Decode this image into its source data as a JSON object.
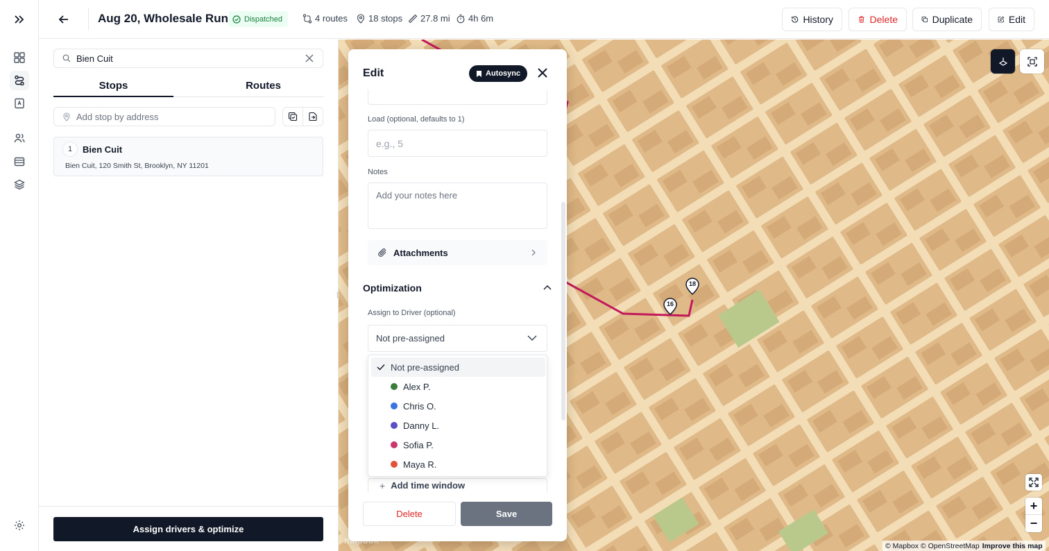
{
  "header": {
    "title": "Aug 20, Wholesale Run",
    "status": "Dispatched",
    "routes": "4 routes",
    "stops": "18 stops",
    "distance": "27.8 mi",
    "duration": "4h 6m",
    "buttons": {
      "history": "History",
      "delete": "Delete",
      "duplicate": "Duplicate",
      "edit": "Edit"
    }
  },
  "left": {
    "search_value": "Bien Cuit",
    "tabs": [
      "Stops",
      "Routes"
    ],
    "active_tab": "Stops",
    "add_stop_placeholder": "Add stop by address",
    "stops": [
      {
        "number": "1",
        "name": "Bien Cuit",
        "address": "Bien Cuit, 120 Smith St, Brooklyn, NY 11201"
      }
    ],
    "assign_button": "Assign drivers & optimize"
  },
  "edit_panel": {
    "title": "Edit",
    "autosync": "Autosync",
    "load_label": "Load (optional, defaults to 1)",
    "load_placeholder": "e.g., 5",
    "notes_label": "Notes",
    "notes_placeholder": "Add your notes here",
    "attachments": "Attachments",
    "optimization": "Optimization",
    "assign_label": "Assign to Driver (optional)",
    "assign_value": "Not pre-assigned",
    "dropdown": [
      {
        "label": "Not pre-assigned",
        "color": "",
        "selected": true
      },
      {
        "label": "Alex P.",
        "color": "#3a7d3a"
      },
      {
        "label": "Chris O.",
        "color": "#3b72e0"
      },
      {
        "label": "Danny L.",
        "color": "#5b4fc7"
      },
      {
        "label": "Sofia P.",
        "color": "#c9366b"
      },
      {
        "label": "Maya R.",
        "color": "#e0533a"
      }
    ],
    "add_time_window": "Add time window",
    "delete": "Delete",
    "save": "Save"
  },
  "map": {
    "markers": [
      "18",
      "16"
    ],
    "attribution": "© Mapbox © OpenStreetMap",
    "improve": "Improve this map",
    "logo": "mapbox",
    "zoom_in": "+",
    "zoom_out": "−",
    "route_color": "#c2185b"
  }
}
